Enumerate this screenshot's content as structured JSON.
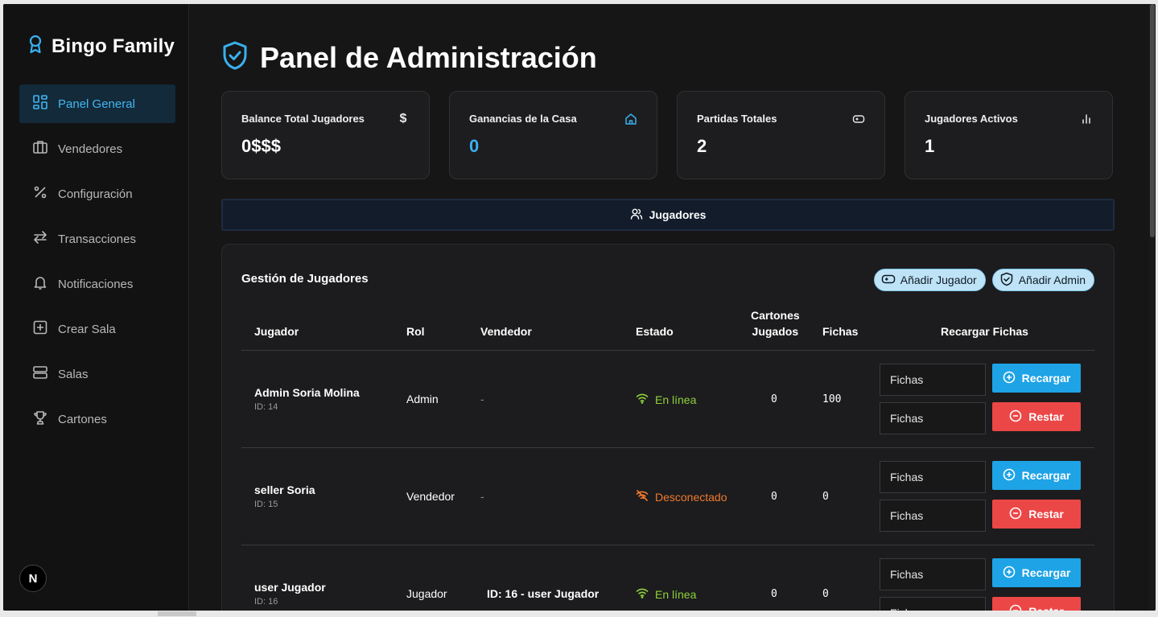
{
  "brand": {
    "name": "Bingo Family"
  },
  "sidebar": {
    "items": [
      {
        "label": "Panel General",
        "icon": "dashboard-icon",
        "active": true
      },
      {
        "label": "Vendedores",
        "icon": "briefcase-icon",
        "active": false
      },
      {
        "label": "Configuración",
        "icon": "percent-icon",
        "active": false
      },
      {
        "label": "Transacciones",
        "icon": "arrows-swap-icon",
        "active": false
      },
      {
        "label": "Notificaciones",
        "icon": "bell-icon",
        "active": false
      },
      {
        "label": "Crear Sala",
        "icon": "plus-square-icon",
        "active": false
      },
      {
        "label": "Salas",
        "icon": "server-icon",
        "active": false
      },
      {
        "label": "Cartones",
        "icon": "trophy-icon",
        "active": false
      }
    ],
    "badge": "N"
  },
  "header": {
    "title": "Panel de Administración"
  },
  "stats": [
    {
      "label": "Balance Total Jugadores",
      "value": "0$$$",
      "icon": "dollar-icon"
    },
    {
      "label": "Ganancias de la Casa",
      "value": "0",
      "icon": "home-icon",
      "accent": "#3ab0ee"
    },
    {
      "label": "Partidas Totales",
      "value": "2",
      "icon": "gamepad-icon"
    },
    {
      "label": "Jugadores Activos",
      "value": "1",
      "icon": "bar-chart-icon"
    }
  ],
  "tabs": {
    "active_label": "Jugadores"
  },
  "panel": {
    "title": "Gestión de Jugadores",
    "add_player": "Añadir Jugador",
    "add_admin": "Añadir Admin",
    "columns": {
      "player": "Jugador",
      "role": "Rol",
      "seller": "Vendedor",
      "status": "Estado",
      "cards_played_1": "Cartones",
      "cards_played_2": "Jugados",
      "chips": "Fichas",
      "reload": "Recargar Fichas"
    },
    "rows": [
      {
        "name": "Admin Soria Molina",
        "id": "ID: 14",
        "role": "Admin",
        "seller": "-",
        "status": "En línea",
        "cards": "0",
        "chips": "100"
      },
      {
        "name": "seller Soria",
        "id": "ID: 15",
        "role": "Vendedor",
        "seller": "-",
        "status": "Desconectado",
        "cards": "0",
        "chips": "0"
      },
      {
        "name": "user Jugador",
        "id": "ID: 16",
        "role": "Jugador",
        "seller": "ID: 16 - user Jugador",
        "status": "En línea",
        "cards": "0",
        "chips": "0"
      }
    ],
    "input_placeholder": "Fichas",
    "recharge_label": "Recargar",
    "subtract_label": "Restar"
  },
  "colors": {
    "accent": "#1ea3e6",
    "danger": "#ec4747",
    "online": "#8fd13a",
    "offline": "#f07a2e"
  }
}
